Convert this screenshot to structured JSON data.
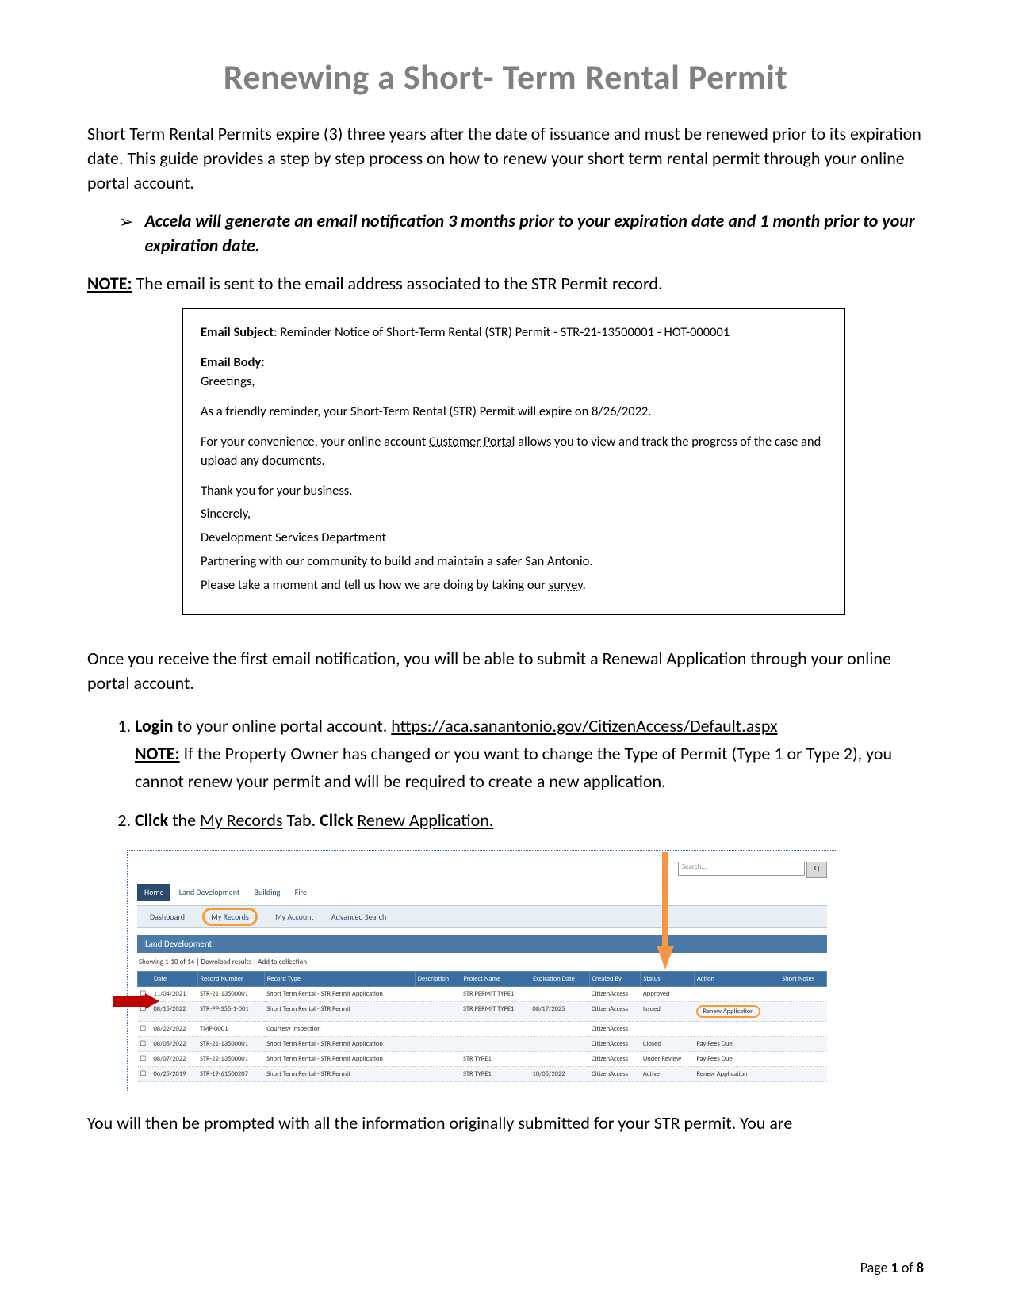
{
  "title": "Renewing a Short- Term Rental Permit",
  "intro": "Short Term Rental Permits expire (3) three years after the date of issuance and must be renewed prior to its expiration date. This guide provides a step by step process on how to renew your short term rental permit through your online portal account.",
  "bullet": "Accela will generate an email notification 3 months prior to your expiration date and 1 month prior to your expiration date.",
  "note_label": "NOTE:",
  "note_text": " The email is sent to the email address associated to the STR Permit record.",
  "email": {
    "subject_label": "Email Subject",
    "subject_text": ": Reminder Notice of Short-Term Rental (STR) Permit - STR-21-13500001 - HOT-000001",
    "body_label": "Email Body:",
    "greeting": "Greetings,",
    "p1": "As a friendly reminder, your Short-Term Rental (STR) Permit will expire on 8/26/2022.",
    "p2a": "For your convenience, your online account ",
    "p2link": "Customer Portal",
    "p2b": " allows you to view and track the progress of the case and upload any documents.",
    "p3": "Thank you for your business.",
    "p4": "Sincerely,",
    "p5": "Development Services Department",
    "p6": "Partnering with our community to build and maintain a safer San Antonio.",
    "p7a": "Please take a moment and tell us how we are doing by taking our ",
    "p7link": "survey",
    "p7b": "."
  },
  "after_email": "Once you receive the first email notification, you will be able to submit a Renewal Application through your online portal account.",
  "steps": {
    "s1_login": "Login",
    "s1_rest": " to your online portal account. ",
    "s1_url": "https://aca.sanantonio.gov/CitizenAccess/Default.aspx",
    "s1_note_label": "NOTE:",
    "s1_note_text": " If the Property Owner has changed or you want to change the Type of Permit (Type 1 or Type 2), you cannot renew your permit and will be required to create a new application.",
    "s2_click1": "Click",
    "s2_mid1": " the ",
    "s2_tab": "My Records",
    "s2_mid2": " Tab. ",
    "s2_click2": "Click",
    "s2_mid3": "  ",
    "s2_renew": "Renew  Application."
  },
  "screenshot": {
    "search_placeholder": "Search...",
    "go_label": "Q",
    "tab_home": "Home",
    "tab_land": "Land Development",
    "tab_building": "Building",
    "tab_fire": "Fire",
    "sub_dashboard": "Dashboard",
    "sub_myrecords": "My Records",
    "sub_myaccount": "My Account",
    "sub_advsearch": "Advanced Search",
    "section": "Land Development",
    "hint": "Showing 1-10 of 14  |  Download results  |  Add to collection",
    "headers": [
      "",
      "Date",
      "Record Number",
      "Record Type",
      "Description",
      "Project Name",
      "Expiration Date",
      "Created By",
      "Status",
      "Action",
      "Short Notes"
    ],
    "rows": [
      [
        "",
        "11/04/2021",
        "STR-21-13500001",
        "Short Term Rental - STR Permit Application",
        "",
        "STR PERMIT TYPE1",
        "",
        "CitizenAccess",
        "Approved",
        "",
        ""
      ],
      [
        "",
        "08/15/2022",
        "STR-PP-355-1-001",
        "Short Term Rental - STR Permit",
        "",
        "STR PERMIT TYPE1",
        "08/17/2025",
        "CitizenAccess",
        "Issued",
        "Renew Application",
        ""
      ],
      [
        "",
        "08/22/2022",
        "TMP-0001",
        "Courtesy Inspection",
        "",
        "",
        "",
        "CitizenAccess",
        "",
        "",
        ""
      ],
      [
        "",
        "08/05/2022",
        "STR-21-13500001",
        "Short Term Rental - STR Permit Application",
        "",
        "",
        "",
        "CitizenAccess",
        "Closed",
        "Pay Fees Due",
        ""
      ],
      [
        "",
        "08/07/2022",
        "STR-22-13500001",
        "Short Term Rental - STR Permit Application",
        "",
        "STR TYPE1",
        "",
        "CitizenAccess",
        "Under Review",
        "Pay Fees Due",
        ""
      ],
      [
        "",
        "06/25/2019",
        "STR-19-61500207",
        "Short Term Rental - STR Permit",
        "",
        "STR TYPE1",
        "10/05/2022",
        "CitizenAccess",
        "Active",
        "Renew Application",
        ""
      ]
    ],
    "renew_action": "Renew Application"
  },
  "after_shot": "You will then be prompted with all the information originally submitted for your STR permit. You are",
  "pagenum_a": "Page ",
  "pagenum_b": "1",
  "pagenum_c": " of ",
  "pagenum_d": "8"
}
